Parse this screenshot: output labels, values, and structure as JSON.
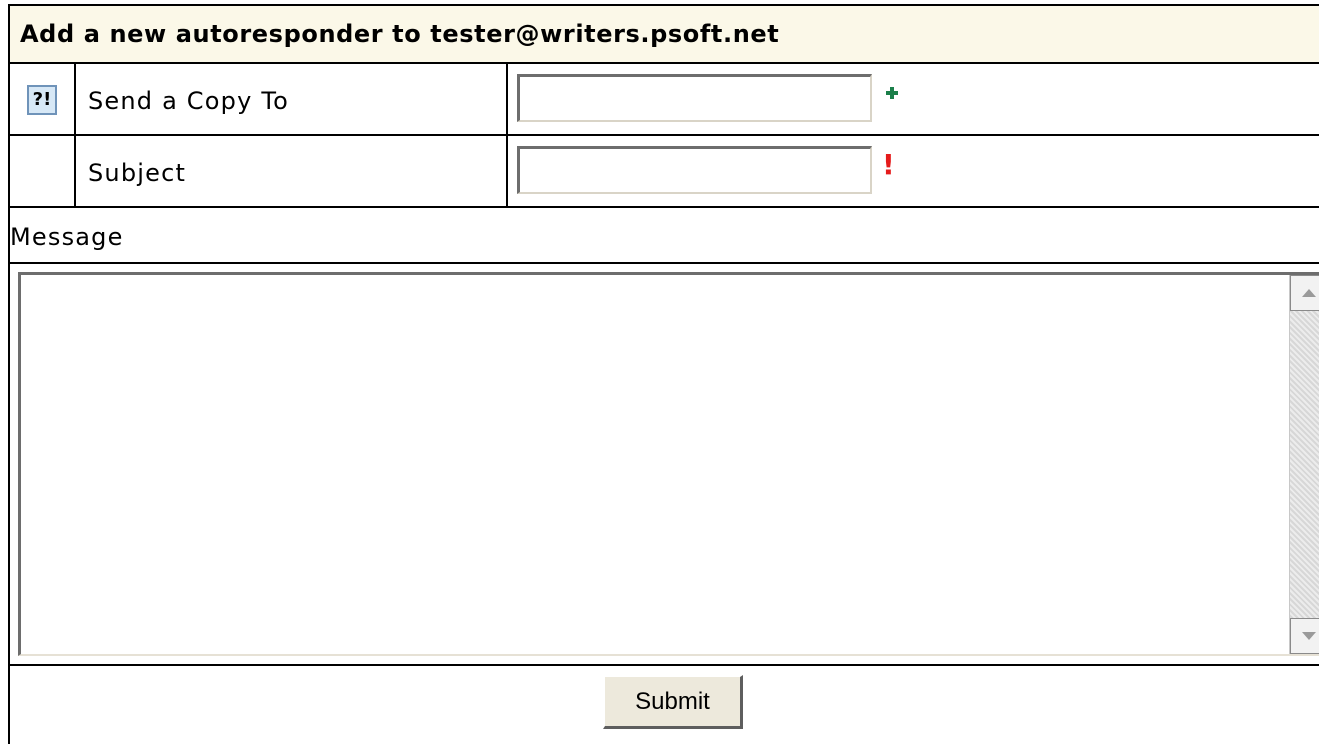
{
  "form": {
    "title": "Add a new autoresponder to tester@writers.psoft.net",
    "help_icon_text": "?!",
    "fields": {
      "send_copy_to": {
        "label": "Send a Copy To",
        "value": "",
        "indicator": "+"
      },
      "subject": {
        "label": "Subject",
        "value": "",
        "indicator": "!"
      }
    },
    "message": {
      "label": "Message",
      "value": ""
    },
    "submit_label": "Submit"
  },
  "colors": {
    "title_background": "#fbf8e8",
    "add_indicator": "#1b7f4a",
    "required_indicator": "#e51b1b",
    "help_icon_background": "#d7e8f6"
  },
  "icons": {
    "help": "help-icon",
    "add": "plus-icon",
    "required": "required-icon"
  }
}
